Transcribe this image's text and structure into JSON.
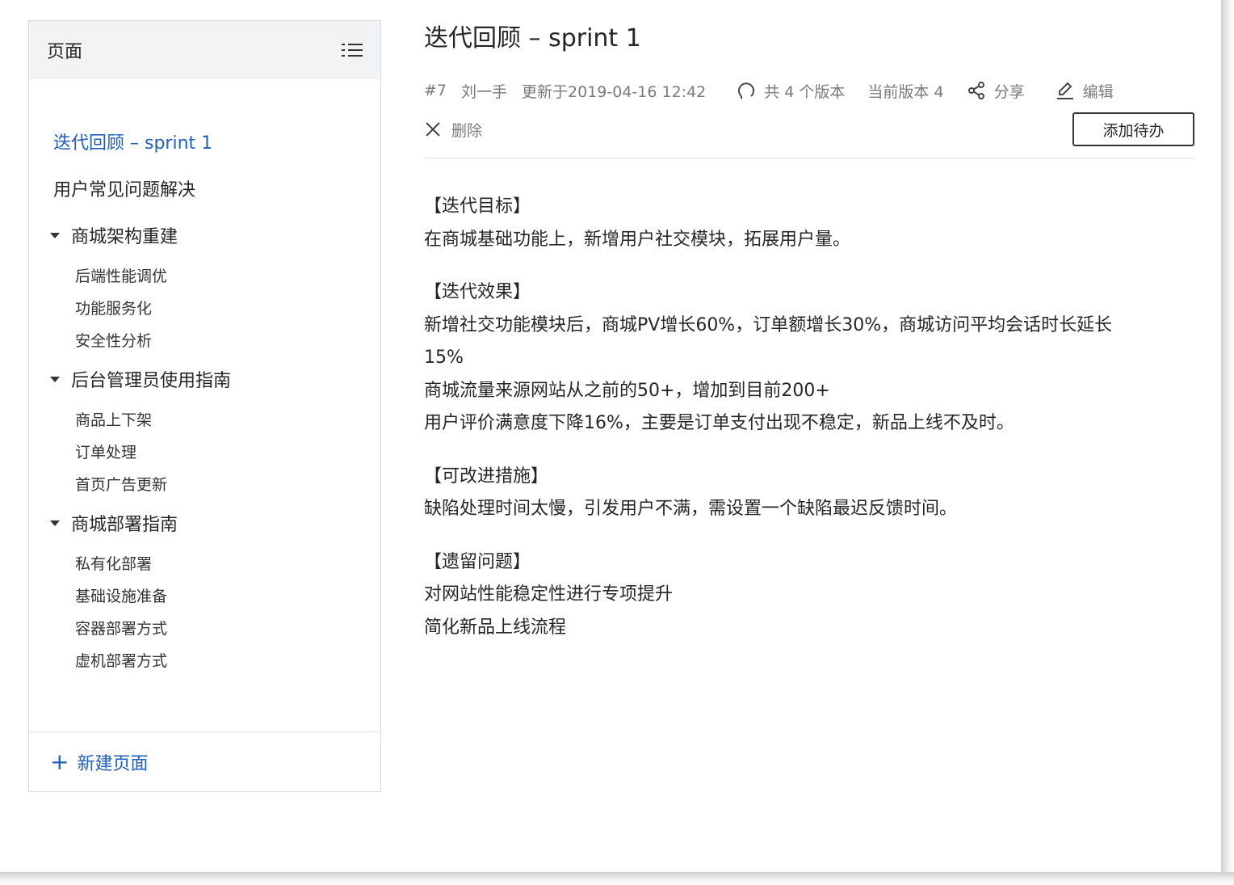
{
  "sidebar": {
    "title": "页面",
    "items": [
      {
        "label": "迭代回顾 – sprint 1",
        "level": 0,
        "active": true,
        "expandable": false
      },
      {
        "label": "用户常见问题解决",
        "level": 0,
        "active": false,
        "expandable": false
      },
      {
        "label": "商城架构重建",
        "level": 0,
        "active": false,
        "expandable": true
      },
      {
        "label": "后端性能调优",
        "level": 1
      },
      {
        "label": "功能服务化",
        "level": 1
      },
      {
        "label": "安全性分析",
        "level": 1
      },
      {
        "label": "后台管理员使用指南",
        "level": 0,
        "active": false,
        "expandable": true
      },
      {
        "label": "商品上下架",
        "level": 1
      },
      {
        "label": "订单处理",
        "level": 1
      },
      {
        "label": "首页广告更新",
        "level": 1
      },
      {
        "label": "商城部署指南",
        "level": 0,
        "active": false,
        "expandable": true
      },
      {
        "label": "私有化部署",
        "level": 1
      },
      {
        "label": "基础设施准备",
        "level": 1
      },
      {
        "label": "容器部署方式",
        "level": 1
      },
      {
        "label": "虚机部署方式",
        "level": 1
      }
    ],
    "new_page_label": "新建页面"
  },
  "main": {
    "title": "迭代回顾 – sprint 1",
    "meta": {
      "id": "#7",
      "author": "刘一手",
      "updated": "更新于2019-04-16 12:42",
      "versions": "共 4 个版本",
      "current_version": "当前版本 4",
      "share": "分享",
      "edit": "编辑",
      "delete": "删除",
      "add_todo": "添加待办"
    },
    "sections": [
      {
        "heading": "【迭代目标】",
        "lines": [
          "在商城基础功能上，新增用户社交模块，拓展用户量。"
        ]
      },
      {
        "heading": "【迭代效果】",
        "lines": [
          "新增社交功能模块后，商城PV增长60%，订单额增长30%，商城访问平均会话时长延长",
          "15%",
          "商城流量来源网站从之前的50+，增加到目前200+",
          "用户评价满意度下降16%，主要是订单支付出现不稳定，新品上线不及时。"
        ]
      },
      {
        "heading": "【可改进措施】",
        "lines": [
          "缺陷处理时间太慢，引发用户不满，需设置一个缺陷最迟反馈时间。"
        ]
      },
      {
        "heading": "【遗留问题】",
        "lines": [
          "对网站性能稳定性进行专项提升",
          "简化新品上线流程"
        ]
      }
    ]
  },
  "colors": {
    "accent": "#1f5fbf",
    "sidebar_header_bg": "#f2f3f5",
    "meta_text": "#7a7a7a"
  }
}
